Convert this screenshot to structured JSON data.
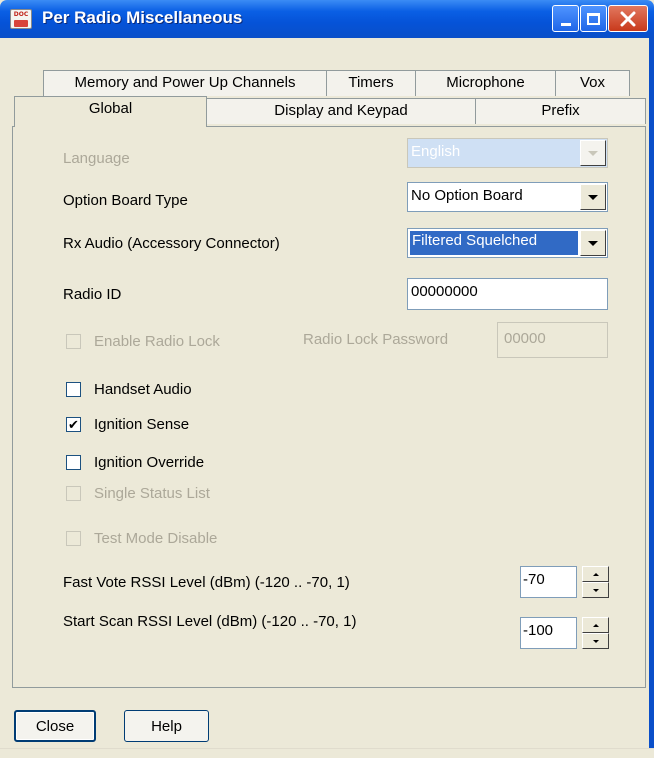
{
  "window": {
    "title": "Per Radio Miscellaneous",
    "icon_label": "DOC"
  },
  "tabs": {
    "row1": [
      "Memory and Power Up Channels",
      "Timers",
      "Microphone",
      "Vox"
    ],
    "row2": [
      "Global",
      "Display and Keypad",
      "Prefix"
    ],
    "active": "Global"
  },
  "form": {
    "language": {
      "label": "Language",
      "value": "English",
      "enabled": false
    },
    "option_board_type": {
      "label": "Option Board Type",
      "value": "No Option Board"
    },
    "rx_audio": {
      "label": "Rx Audio (Accessory Connector)",
      "value": "Filtered Squelched"
    },
    "radio_id": {
      "label": "Radio ID",
      "value": "00000000"
    },
    "enable_radio_lock": {
      "label": "Enable Radio Lock",
      "checked": false,
      "enabled": false
    },
    "radio_lock_password": {
      "label": "Radio Lock Password",
      "value": "00000",
      "enabled": false
    },
    "handset_audio": {
      "label": "Handset Audio",
      "checked": false,
      "check_glyph": ""
    },
    "ignition_sense": {
      "label": "Ignition Sense",
      "checked": true,
      "check_glyph": "✔"
    },
    "ignition_override": {
      "label": "Ignition Override",
      "checked": false,
      "check_glyph": ""
    },
    "single_status_list": {
      "label": "Single Status List",
      "checked": false,
      "enabled": false
    },
    "test_mode_disable": {
      "label": "Test Mode Disable",
      "checked": false,
      "enabled": false
    },
    "fast_vote_rssi": {
      "label": "Fast Vote RSSI Level (dBm) (-120 .. -70, 1)",
      "value": "-70"
    },
    "start_scan_rssi": {
      "label": "Start Scan RSSI Level (dBm) (-120 .. -70, 1)",
      "value": "-100"
    }
  },
  "footer": {
    "close_label": "Close",
    "help_label": "Help"
  },
  "colors": {
    "titlebar": "#0a5fe4",
    "dialog_bg": "#ece9d8",
    "selection": "#316ac5",
    "close_button": "#c8391b"
  }
}
